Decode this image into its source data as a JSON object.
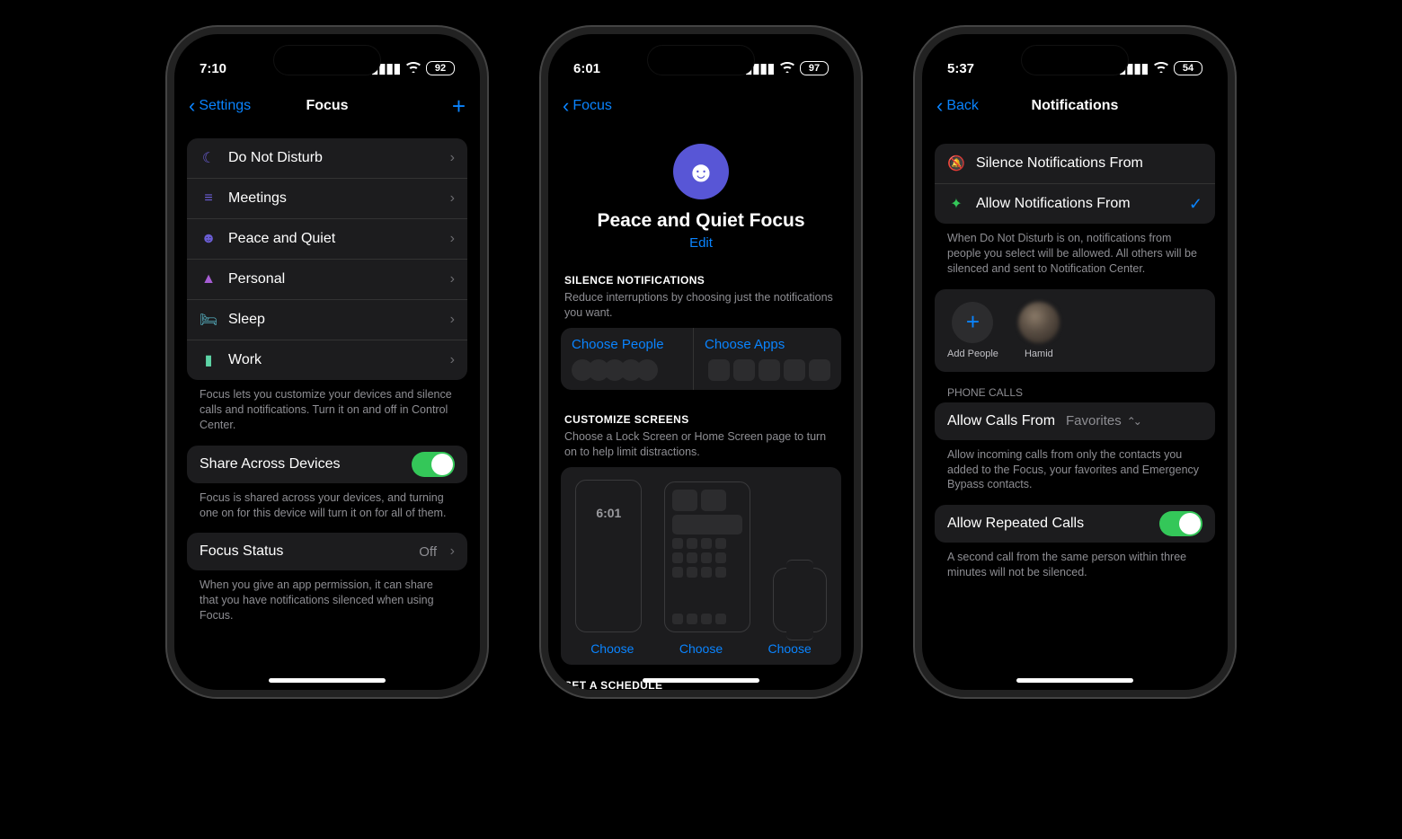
{
  "phone1": {
    "status": {
      "time": "7:10",
      "battery": "92"
    },
    "nav": {
      "back": "Settings",
      "title": "Focus"
    },
    "focus_list": [
      {
        "icon": "moon",
        "label": "Do Not Disturb"
      },
      {
        "icon": "list",
        "label": "Meetings"
      },
      {
        "icon": "smile",
        "label": "Peace and Quiet"
      },
      {
        "icon": "person",
        "label": "Personal"
      },
      {
        "icon": "bed",
        "label": "Sleep"
      },
      {
        "icon": "badge",
        "label": "Work"
      }
    ],
    "footer1": "Focus lets you customize your devices and silence calls and notifications. Turn it on and off in Control Center.",
    "share_label": "Share Across Devices",
    "footer2": "Focus is shared across your devices, and turning one on for this device will turn it on for all of them.",
    "focus_status_label": "Focus Status",
    "focus_status_value": "Off",
    "footer3": "When you give an app permission, it can share that you have notifications silenced when using Focus."
  },
  "phone2": {
    "status": {
      "time": "6:01",
      "battery": "97"
    },
    "nav": {
      "back": "Focus"
    },
    "title": "Peace and Quiet Focus",
    "edit": "Edit",
    "silence_head": "SILENCE NOTIFICATIONS",
    "silence_sub": "Reduce interruptions by choosing just the notifications you want.",
    "choose_people": "Choose People",
    "choose_apps": "Choose Apps",
    "customize_head": "CUSTOMIZE SCREENS",
    "customize_sub": "Choose a Lock Screen or Home Screen page to turn on to help limit distractions.",
    "lock_time": "6:01",
    "choose": "Choose",
    "schedule_head": "SET A SCHEDULE"
  },
  "phone3": {
    "status": {
      "time": "5:37",
      "battery": "54"
    },
    "nav": {
      "back": "Back",
      "title": "Notifications"
    },
    "silence_from": "Silence Notifications From",
    "allow_from": "Allow Notifications From",
    "mode_footer": "When Do Not Disturb is on, notifications from people you select will be allowed. All others will be silenced and sent to Notification Center.",
    "add_people": "Add People",
    "contact_name": "Hamid",
    "phone_calls_head": "PHONE CALLS",
    "allow_calls_label": "Allow Calls From",
    "allow_calls_value": "Favorites",
    "calls_footer": "Allow incoming calls from only the contacts you added to the Focus, your favorites and Emergency Bypass contacts.",
    "repeated_label": "Allow Repeated Calls",
    "repeated_footer": "A second call from the same person within three minutes will not be silenced."
  }
}
